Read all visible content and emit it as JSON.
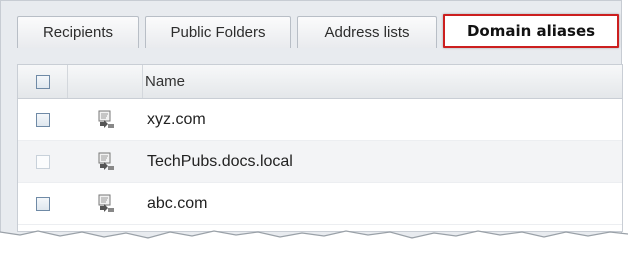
{
  "tabs": [
    {
      "label": "Recipients",
      "active": false
    },
    {
      "label": "Public Folders",
      "active": false
    },
    {
      "label": "Address lists",
      "active": false
    },
    {
      "label": "Domain aliases",
      "active": true
    }
  ],
  "grid": {
    "header": {
      "name": "Name"
    },
    "rows": [
      {
        "name": "xyz.com",
        "icon": "domain-alias-icon"
      },
      {
        "name": "TechPubs.docs.local",
        "icon": "domain-alias-icon"
      },
      {
        "name": "abc.com",
        "icon": "domain-alias-icon"
      }
    ]
  },
  "colors": {
    "active_tab_border": "#cc1f1f",
    "panel_bg": "#e8ebef"
  }
}
